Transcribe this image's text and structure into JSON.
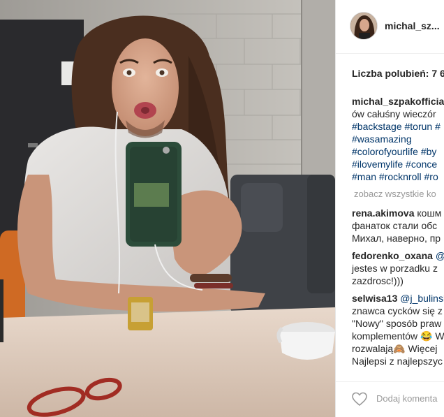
{
  "post": {
    "username": "michal_sz...",
    "likes_label": "Liczba polubień: 7 6",
    "caption": {
      "user": "michal_szpakofficial",
      "line1_rest": "",
      "line2": "ów całuśny wieczór",
      "line3": "#backstage #torun #",
      "line4": "#wasamazing",
      "line5": "#colorofyourlife #by",
      "line6": "#ilovemylife #conce",
      "line7": "#man #rocknroll #ro"
    },
    "view_all_label": "zobacz wszystkie ko"
  },
  "comments": [
    {
      "user": "rena.akimova",
      "line1": "кошм",
      "line2": "фанаток стали обс",
      "line3": "Михал, наверно, пр"
    },
    {
      "user": "fedorenko_oxana",
      "line1": "@j",
      "line2": "jestes w porzadku z",
      "line3": "zazdrosc!)))"
    },
    {
      "user": "selwisa13",
      "line1": "@j_bulinsk",
      "line2": "znawca cycków się z",
      "line3": "\"Nowy\" sposób praw",
      "line4": "komplementów 😂 W",
      "line5": "rozwalają🙈 Więcej",
      "line6": "Najlepsi z najlepszyc"
    }
  ],
  "footer": {
    "add_comment_placeholder": "Dodaj komenta"
  },
  "colors": {
    "hashtag": "#003569",
    "text": "#262626",
    "muted": "#999999"
  },
  "icons": {
    "like": "heart-icon"
  }
}
